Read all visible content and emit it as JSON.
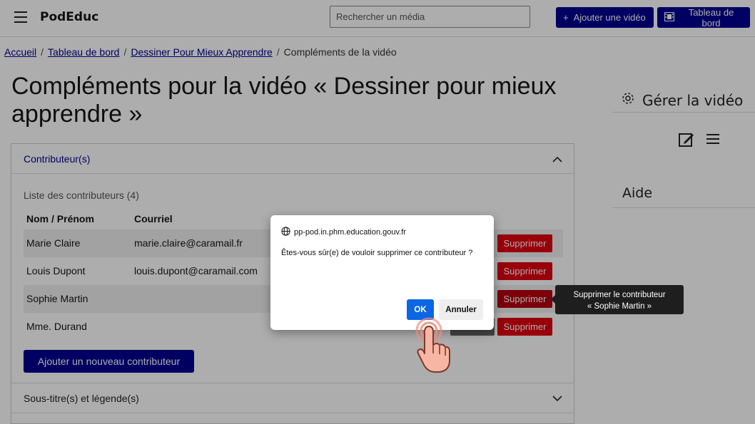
{
  "header": {
    "brand": "PodEduc",
    "search_placeholder": "Rechercher un média",
    "add_video_label": "Ajouter une vidéo",
    "dashboard_label": "Tableau de bord"
  },
  "breadcrumb": {
    "items": [
      "Accueil",
      "Tableau de bord",
      "Dessiner Pour Mieux Apprendre"
    ],
    "current": "Compléments de la vidéo"
  },
  "page": {
    "title": "Compléments pour la vidéo « Dessiner pour mieux apprendre »"
  },
  "contributors": {
    "section_label": "Contributeur(s)",
    "list_caption": "Liste des contributeurs (4)",
    "columns": [
      "Nom / Prénom",
      "Courriel"
    ],
    "rows": [
      {
        "name": "Marie Claire",
        "email": "marie.claire@caramail.fr"
      },
      {
        "name": "Louis Dupont",
        "email": "louis.dupont@caramail.com"
      },
      {
        "name": "Sophie Martin",
        "email": ""
      },
      {
        "name": "Mme. Durand",
        "email": ""
      }
    ],
    "delete_label": "Supprimer",
    "add_label": "Ajouter un nouveau contributeur"
  },
  "subtitles": {
    "section_label": "Sous-titre(s) et légende(s)"
  },
  "sidebar": {
    "manage_label": "Gérer la vidéo",
    "help_label": "Aide"
  },
  "tooltip": {
    "line1": "Supprimer le contributeur",
    "line2": "« Sophie Martin »"
  },
  "dialog": {
    "origin": "pp-pod.in.phm.education.gouv.fr",
    "message": "Êtes-vous sûr(e) de vouloir supprimer ce contributeur ?",
    "ok_label": "OK",
    "cancel_label": "Annuler"
  },
  "colors": {
    "primary": "#000091",
    "danger": "#e1000f",
    "dialog_ok": "#0b66e4"
  }
}
